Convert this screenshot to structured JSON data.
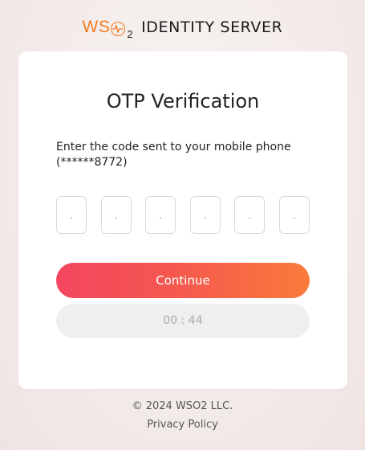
{
  "brand": {
    "logo_prefix": "WS",
    "logo_subscript": "2",
    "product": "IDENTITY SERVER",
    "accent_color": "#f47b20"
  },
  "card": {
    "title": "OTP Verification",
    "description": "Enter the code sent to your mobile phone (******8772)",
    "otp_placeholders": [
      ".",
      ".",
      ".",
      ".",
      ".",
      "."
    ],
    "continue_label": "Continue",
    "timer": "00 : 44",
    "button_gradient": [
      "#f3465f",
      "#fb7b3c"
    ]
  },
  "footer": {
    "copyright": "© 2024 WSO2 LLC.",
    "privacy": "Privacy Policy"
  }
}
